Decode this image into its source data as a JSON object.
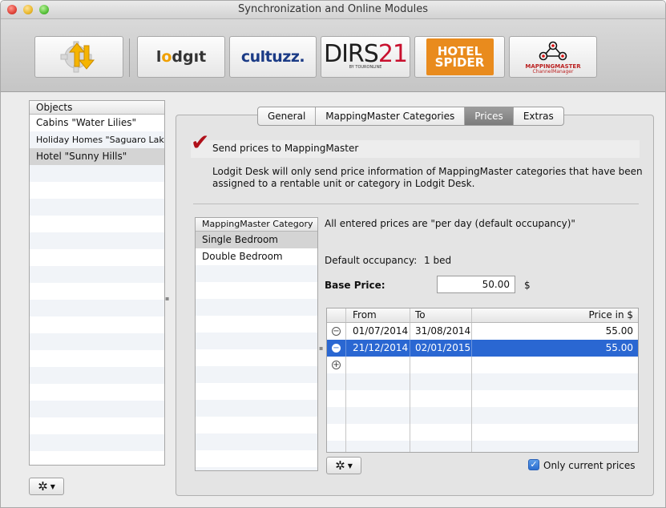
{
  "window": {
    "title": "Synchronization and Online Modules"
  },
  "toolbar": {
    "lodgit": {
      "pre": "l",
      "o": "o",
      "post": "dgıt"
    },
    "cultuzz": "cultuzz.",
    "dirs21": {
      "main": "DIRS",
      "num": "21",
      "by": "BY TOURONLINE"
    },
    "hotelspider": {
      "l1": "HOTEL",
      "l2": "SPIDER"
    },
    "mappingmaster": {
      "l1": "MAPPINGMASTER",
      "l2": "ChannelManager"
    }
  },
  "objects": {
    "header": "Objects",
    "items": [
      "Cabins \"Water Lilies\"",
      "Holiday Homes \"Saguaro Lake\"",
      "Hotel \"Sunny Hills\""
    ],
    "selected_index": 2
  },
  "tabs": [
    "General",
    "MappingMaster Categories",
    "Prices",
    "Extras"
  ],
  "active_tab": "Prices",
  "prices": {
    "send_label": "Send prices to MappingMaster",
    "send_checked": true,
    "info": "Lodgit Desk will only send price information of MappingMaster categories that have been assigned to a rentable unit or category in Lodgit Desk.",
    "per_day_note": "All entered prices are \"per day (default occupancy)\"",
    "default_occupancy_label": "Default occupancy:",
    "default_occupancy_value": "1 bed",
    "base_price_label": "Base Price:",
    "base_price_value": "50.00",
    "currency": "$",
    "only_current_label": "Only current prices",
    "only_current_checked": true
  },
  "categories": {
    "header": "MappingMaster Category",
    "items": [
      "Single Bedroom",
      "Double Bedroom"
    ],
    "selected_index": 0
  },
  "price_table": {
    "headers": {
      "from": "From",
      "to": "To",
      "price": "Price in $"
    },
    "rows": [
      {
        "from": "01/07/2014",
        "to": "31/08/2014",
        "price": "55.00"
      },
      {
        "from": "21/12/2014",
        "to": "02/01/2015",
        "price": "55.00"
      }
    ],
    "selected_index": 1
  },
  "icons": {
    "remove": "⊖",
    "add": "⊕",
    "gear": "✲"
  }
}
